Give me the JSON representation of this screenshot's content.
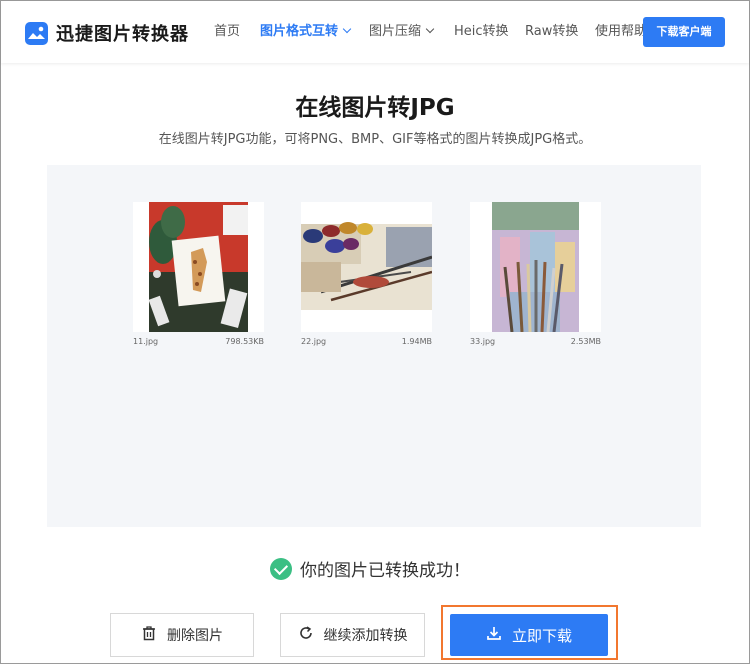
{
  "header": {
    "logo_text": "迅捷图片转换器",
    "nav": [
      {
        "label": "首页"
      },
      {
        "label": "图片格式互转"
      },
      {
        "label": "图片压缩"
      },
      {
        "label": "Heic转换"
      },
      {
        "label": "Raw转换"
      },
      {
        "label": "使用帮助"
      }
    ],
    "download_client_label": "下载客户端"
  },
  "main": {
    "title": "在线图片转JPG",
    "subtitle": "在线图片转JPG功能，可将PNG、BMP、GIF等格式的图片转换成JPG格式。",
    "files": [
      {
        "name": "11.jpg",
        "size": "798.53KB"
      },
      {
        "name": "22.jpg",
        "size": "1.94MB"
      },
      {
        "name": "33.jpg",
        "size": "2.53MB"
      }
    ],
    "success_text": "你的图片已转换成功！",
    "delete_label": "删除图片",
    "continue_label": "继续添加转换",
    "download_label": "立即下载"
  },
  "colors": {
    "accent": "#2d7bf4",
    "success": "#3bbf84",
    "highlight": "#f2772f",
    "panel": "#f4f6f9"
  },
  "icons": [
    "image-logo-icon",
    "chevron-down-icon",
    "check-circle-icon",
    "trash-icon",
    "refresh-icon",
    "download-icon"
  ]
}
